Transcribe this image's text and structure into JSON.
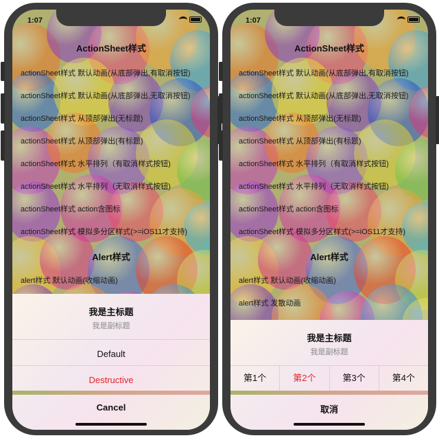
{
  "status_bar": {
    "time": "1:07"
  },
  "sections": {
    "actionsheet_title": "ActionSheet样式",
    "alert_title": "Alert样式"
  },
  "actionsheet_rows": [
    "actionSheet样式 默认动画(从底部弹出,有取消按钮)",
    "actionSheet样式 默认动画(从底部弹出,无取消按钮)",
    "actionSheet样式 从顶部弹出(无标题)",
    "actionSheet样式 从顶部弹出(有标题)",
    "actionSheet样式 水平排列（有取消样式按钮)",
    "actionSheet样式 水平排列（无取消样式按钮)",
    "actionSheet样式 action含图标",
    "actionSheet样式 模拟多分区样式(>=iOS11才支持)"
  ],
  "alert_rows": [
    "alert样式 默认动画(收缩动画)",
    "alert样式 发散动画"
  ],
  "left_sheet": {
    "title": "我是主标题",
    "subtitle": "我是副标题",
    "default_label": "Default",
    "destructive_label": "Destructive",
    "cancel_label": "Cancel"
  },
  "right_sheet": {
    "title": "我是主标题",
    "subtitle": "我是副标题",
    "options": [
      "第1个",
      "第2个",
      "第3个",
      "第4个"
    ],
    "cancel_label": "取消"
  },
  "colors": {
    "destructive": "#e0262b",
    "frame": "#3b3b3b"
  }
}
